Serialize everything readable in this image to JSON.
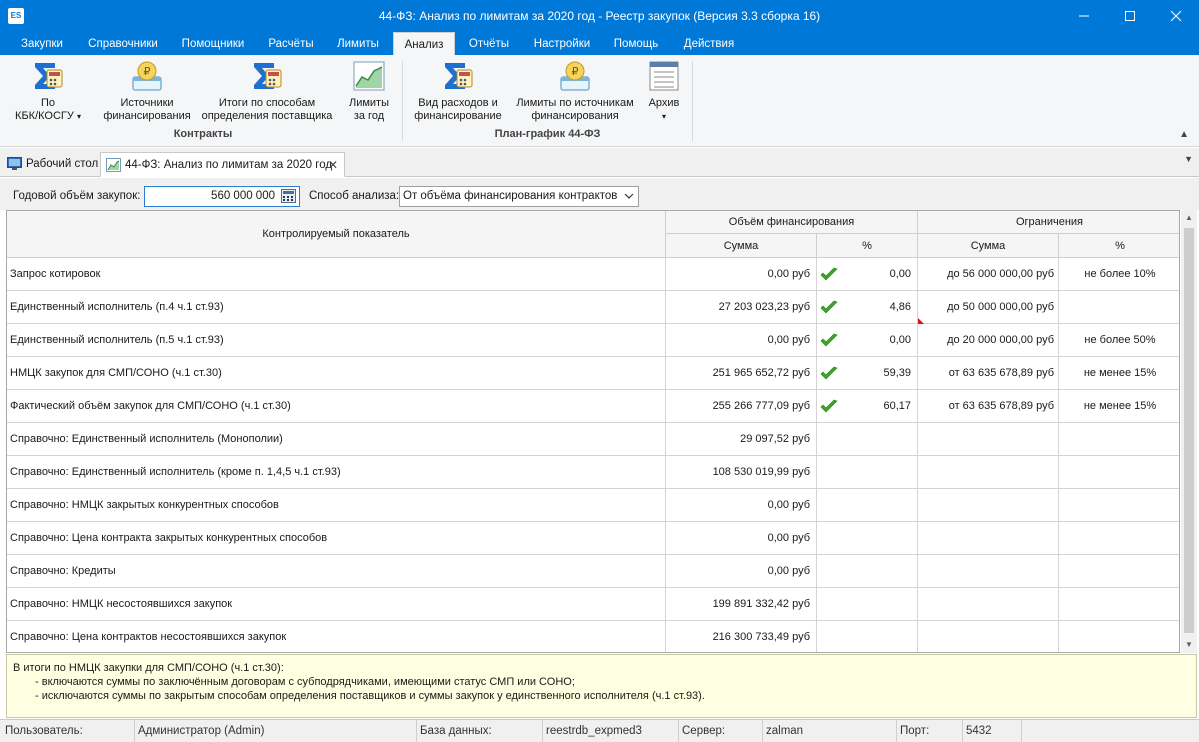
{
  "window": {
    "title": "44-ФЗ: Анализ по лимитам за 2020 год - Реестр закупок (Версия 3.3 сборка 16)",
    "app_icon": "ES"
  },
  "menu": [
    "Закупки",
    "Справочники",
    "Помощники",
    "Расчёты",
    "Лимиты",
    "Анализ",
    "Отчёты",
    "Настройки",
    "Помощь",
    "Действия"
  ],
  "menu_active": "Анализ",
  "ribbon": {
    "buttons": [
      {
        "line1": "По",
        "line2": "КБК/КОСГУ",
        "icon": "sigma-calc-icon"
      },
      {
        "line1": "Источники",
        "line2": "финансирования",
        "icon": "money-sources-icon"
      },
      {
        "line1": "Итоги по способам",
        "line2": "определения поставщика",
        "icon": "sigma-calc-icon"
      },
      {
        "line1": "Лимиты",
        "line2": "за год",
        "icon": "chart-icon"
      },
      {
        "line1": "Вид расходов и",
        "line2": "финансирование",
        "icon": "sigma-calc-icon"
      },
      {
        "line1": "Лимиты по источникам",
        "line2": "финансирования",
        "icon": "money-sources-icon"
      },
      {
        "line1": "Архив",
        "line2": "",
        "icon": "archive-list-icon"
      }
    ],
    "groups": [
      "Контракты",
      "План-график 44-ФЗ"
    ]
  },
  "tabs": [
    {
      "label": "Рабочий стол",
      "icon": "desktop-icon"
    },
    {
      "label": "44-ФЗ: Анализ по лимитам за 2020 год",
      "icon": "chart-icon"
    }
  ],
  "filters": {
    "volume_label": "Годовой объём закупок:",
    "volume_value": "560 000 000",
    "method_label": "Способ анализа:",
    "method_value": "От объёма финансирования контрактов"
  },
  "table": {
    "header_indicator": "Контролируемый показатель",
    "header_financing": "Объём финансирования",
    "header_limits": "Ограничения",
    "header_sum": "Сумма",
    "header_pct": "%",
    "rows": [
      {
        "name": "Запрос котировок",
        "sum": "0,00 руб",
        "ok": true,
        "pct": "0,00",
        "lim_sum": "до 56 000 000,00 руб",
        "lim_pct": "не более 10%"
      },
      {
        "name": "Единственный исполнитель (п.4 ч.1 ст.93)",
        "sum": "27 203 023,23 руб",
        "ok": true,
        "pct": "4,86",
        "lim_sum": "до 50 000 000,00 руб",
        "lim_pct": "",
        "flag": true
      },
      {
        "name": "Единственный исполнитель (п.5 ч.1 ст.93)",
        "sum": "0,00 руб",
        "ok": true,
        "pct": "0,00",
        "lim_sum": "до 20 000 000,00 руб",
        "lim_pct": "не более 50%"
      },
      {
        "name": "НМЦК закупок для СМП/СОНО (ч.1 ст.30)",
        "sum": "251 965 652,72 руб",
        "ok": true,
        "pct": "59,39",
        "lim_sum": "от 63 635 678,89 руб",
        "lim_pct": "не менее 15%"
      },
      {
        "name": "Фактический объём закупок для СМП/СОНО (ч.1 ст.30)",
        "sum": "255 266 777,09 руб",
        "ok": true,
        "pct": "60,17",
        "lim_sum": "от 63 635 678,89 руб",
        "lim_pct": "не менее 15%"
      },
      {
        "name": "Справочно: Единственный исполнитель (Монополии)",
        "sum": "29 097,52 руб",
        "ok": false,
        "pct": "",
        "lim_sum": "",
        "lim_pct": ""
      },
      {
        "name": "Справочно: Единственный исполнитель (кроме п. 1,4,5 ч.1 ст.93)",
        "sum": "108 530 019,99 руб",
        "ok": false,
        "pct": "",
        "lim_sum": "",
        "lim_pct": ""
      },
      {
        "name": "Справочно: НМЦК закрытых конкурентных способов",
        "sum": "0,00 руб",
        "ok": false,
        "pct": "",
        "lim_sum": "",
        "lim_pct": ""
      },
      {
        "name": "Справочно: Цена контракта закрытых конкурентных способов",
        "sum": "0,00 руб",
        "ok": false,
        "pct": "",
        "lim_sum": "",
        "lim_pct": ""
      },
      {
        "name": "Справочно: Кредиты",
        "sum": "0,00 руб",
        "ok": false,
        "pct": "",
        "lim_sum": "",
        "lim_pct": ""
      },
      {
        "name": "Справочно: НМЦК несостоявшихся закупок",
        "sum": "199 891 332,42 руб",
        "ok": false,
        "pct": "",
        "lim_sum": "",
        "lim_pct": ""
      },
      {
        "name": "Справочно: Цена контрактов несостоявшихся закупок",
        "sum": "216 300 733,49 руб",
        "ok": false,
        "pct": "",
        "lim_sum": "",
        "lim_pct": ""
      }
    ]
  },
  "note": [
    "В итоги по НМЦК закупки для СМП/СОНО (ч.1 ст.30):",
    "- включаются суммы по заключённым договорам с субподрядчиками, имеющими статус СМП или СОНО;",
    "- исключаются суммы по закрытым способам определения поставщиков и суммы закупок у единственного исполнителя (ч.1 ст.93)."
  ],
  "status": {
    "user_label": "Пользователь:",
    "user_value": "Администратор (Admin)",
    "db_label": "База данных:",
    "db_value": "reestrdb_expmed3",
    "server_label": "Сервер:",
    "server_value": "zalman",
    "port_label": "Порт:",
    "port_value": "5432"
  },
  "colors": {
    "titlebar": "#0078d7",
    "check": "#3aa827",
    "note_bg": "#ffffe1"
  }
}
